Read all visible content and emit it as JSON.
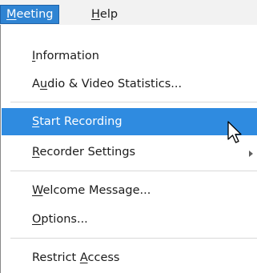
{
  "menubar": {
    "meeting": {
      "pre": "",
      "key": "M",
      "post": "eeting"
    },
    "help": {
      "pre": "",
      "key": "H",
      "post": "elp"
    }
  },
  "menu": {
    "information": {
      "pre": "",
      "key": "I",
      "post": "nformation"
    },
    "av_stats": {
      "pre": "A",
      "key": "u",
      "post": "dio & Video Statistics..."
    },
    "start_recording": {
      "pre": "",
      "key": "S",
      "post": "tart Recording"
    },
    "recorder_settings": {
      "pre": "",
      "key": "R",
      "post": "ecorder Settings"
    },
    "welcome_message": {
      "pre": "",
      "key": "W",
      "post": "elcome Message..."
    },
    "options": {
      "pre": "",
      "key": "O",
      "post": "ptions..."
    },
    "restrict_access": {
      "pre": "Restrict ",
      "key": "A",
      "post": "ccess"
    }
  },
  "colors": {
    "highlight": "#2f8be0",
    "menubar_active": "#2f84d3",
    "menubar_bg": "#f2f2f2"
  },
  "icons": {
    "submenu": "chevron-right-icon",
    "cursor": "mouse-pointer-icon"
  }
}
